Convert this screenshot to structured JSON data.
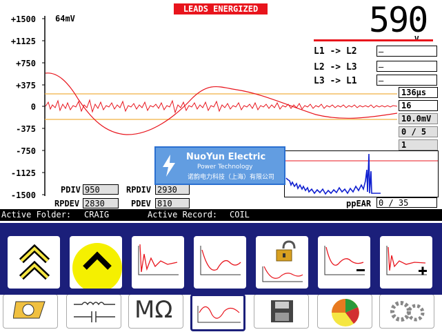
{
  "banner": "LEADS ENERGIZED",
  "voltage": {
    "value": "590",
    "unit": "V"
  },
  "scope": {
    "scale_label": "64mV",
    "y_labels": [
      "+1500",
      "+1125",
      "+750",
      "+375",
      "0",
      "-375",
      "-750",
      "-1125",
      "-1500"
    ]
  },
  "leads": [
    {
      "label": "L1 -> L2",
      "value": "–"
    },
    {
      "label": "L2 -> L3",
      "value": "–"
    },
    {
      "label": "L3 -> L1",
      "value": "–"
    }
  ],
  "params": [
    "136µs",
    "16",
    "10.0mV",
    "0 / 5",
    "1"
  ],
  "pd": {
    "pdiv_label": "PDIV",
    "pdiv_value": "950",
    "rpdiv_label": "RPDIV",
    "rpdiv_value": "2930",
    "rpdev_label": "RPDEV",
    "rpdev_value": "2830",
    "pdev_label": "PDEV",
    "pdev_value": "810"
  },
  "ppear": {
    "label": "ppEAR",
    "value": "0 / 35"
  },
  "status": {
    "folder_label": "Active Folder:",
    "folder": "CRAIG",
    "record_label": "Active Record:",
    "record": "COIL"
  },
  "watermark": {
    "name": "NuoYun Electric",
    "tagline": "Power Technology",
    "chinese": "诺韵电力科技（上海）有限公司"
  },
  "lower_buttons": {
    "megohm": "MΩ"
  },
  "colors": {
    "trace": "#e8141c",
    "threshold": "#f0b040",
    "banner": "#e8141c",
    "toolbar": "#1b1f7a",
    "highlight": "#f5f000",
    "mini_trace": "#1020d0"
  }
}
